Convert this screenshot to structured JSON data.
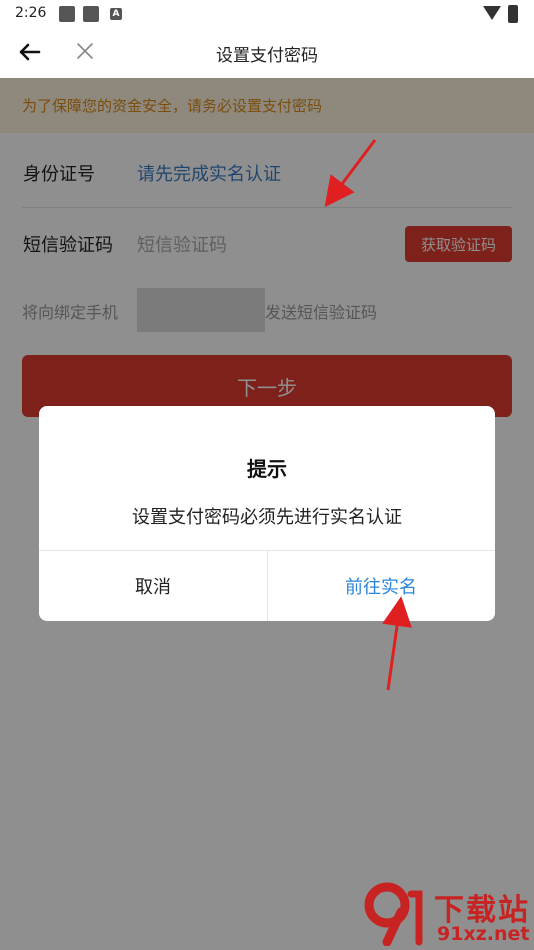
{
  "status_bar": {
    "time": "2:26",
    "badge_letter": "A"
  },
  "header": {
    "title": "设置支付密码"
  },
  "notice": {
    "text": "为了保障您的资金安全，请务必设置支付密码"
  },
  "form": {
    "id_label": "身份证号",
    "id_value": "请先完成实名认证",
    "sms_label": "短信验证码",
    "sms_placeholder": "短信验证码",
    "get_code_label": "获取验证码",
    "hint_prefix": "将向绑定手机",
    "hint_suffix": "发送短信验证码",
    "next_label": "下一步"
  },
  "dialog": {
    "title": "提示",
    "message": "设置支付密码必须先进行实名认证",
    "cancel_label": "取消",
    "confirm_label": "前往实名"
  },
  "watermark": {
    "title": "下载站",
    "domain": "91xz.net"
  },
  "colors": {
    "accent_red": "#e03b2f",
    "link_blue": "#2b86d9",
    "notice_text": "#d98b1a",
    "notice_bg": "#fdf3df"
  }
}
